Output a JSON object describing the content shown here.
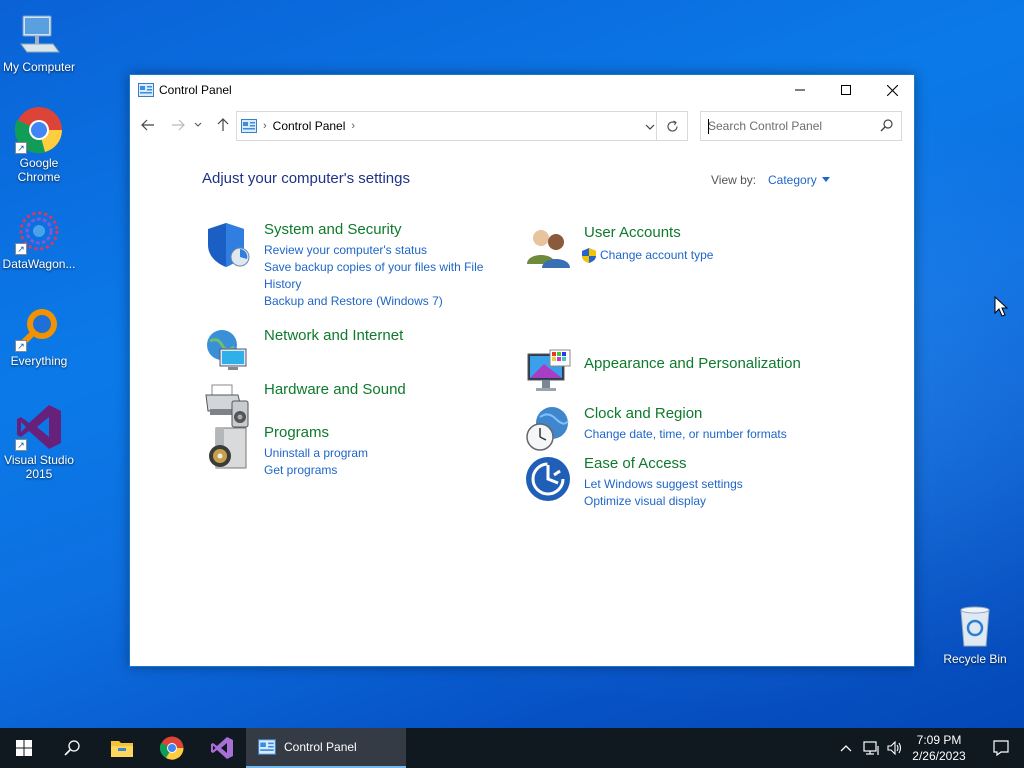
{
  "desktop": {
    "icons": [
      {
        "label": "My Computer",
        "icon": "computer-icon"
      },
      {
        "label": "Google Chrome",
        "icon": "chrome-icon"
      },
      {
        "label": "DataWagon...",
        "icon": "datawagon-icon"
      },
      {
        "label": "Everything",
        "icon": "everything-icon"
      },
      {
        "label": "Visual Studio 2015",
        "icon": "visual-studio-icon"
      },
      {
        "label": "Recycle Bin",
        "icon": "recycle-bin-icon"
      }
    ]
  },
  "window": {
    "title": "Control Panel",
    "address": {
      "crumb": "Control Panel"
    },
    "search": {
      "placeholder": "Search Control Panel"
    },
    "heading": "Adjust your computer's settings",
    "view_by_label": "View by:",
    "view_by_value": "Category",
    "categories_left": [
      {
        "title": "System and Security",
        "icon": "shield-icon",
        "links": [
          "Review your computer's status",
          "Save backup copies of your files with File History",
          "Backup and Restore (Windows 7)"
        ]
      },
      {
        "title": "Network and Internet",
        "icon": "network-icon",
        "links": []
      },
      {
        "title": "Hardware and Sound",
        "icon": "printer-icon",
        "links": []
      },
      {
        "title": "Programs",
        "icon": "programs-icon",
        "links": [
          "Uninstall a program",
          "Get programs"
        ]
      }
    ],
    "categories_right": [
      {
        "title": "User Accounts",
        "icon": "users-icon",
        "links": [
          "Change account type"
        ]
      },
      {
        "title": "Appearance and Personalization",
        "icon": "display-icon",
        "links": []
      },
      {
        "title": "Clock and Region",
        "icon": "clock-icon",
        "links": [
          "Change date, time, or number formats"
        ]
      },
      {
        "title": "Ease of Access",
        "icon": "ease-of-access-icon",
        "links": [
          "Let Windows suggest settings",
          "Optimize visual display"
        ]
      }
    ]
  },
  "taskbar": {
    "active_window_label": "Control Panel",
    "clock_time": "7:09 PM",
    "clock_date": "2/26/2023"
  },
  "colors": {
    "link": "#1e66c8",
    "category_title": "#0e7a2d",
    "heading": "#1e3287",
    "taskbar": "#101820"
  }
}
